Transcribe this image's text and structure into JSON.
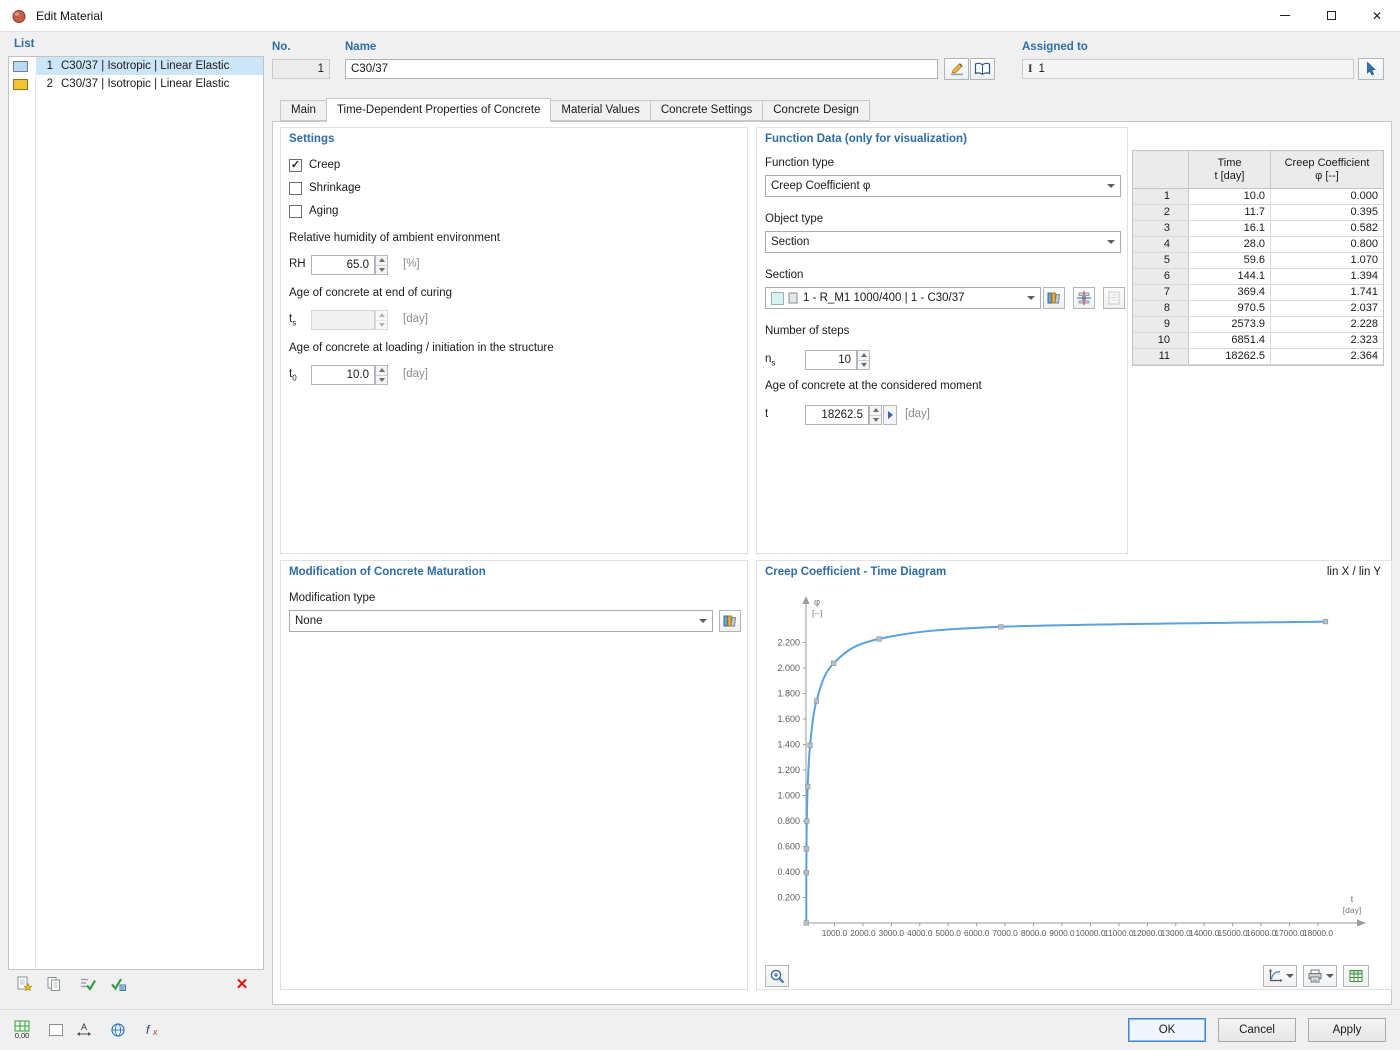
{
  "window": {
    "title": "Edit Material"
  },
  "icons": {
    "close": "✕",
    "delete": "✕",
    "check": "✓"
  },
  "statusbar": {
    "snap_value": "0,00"
  },
  "list_panel": {
    "label": "List",
    "items": [
      {
        "no": "1",
        "name": "C30/37 | Isotropic | Linear Elastic",
        "swatch": "#b7d9f2",
        "selected": true
      },
      {
        "no": "2",
        "name": "C30/37 | Isotropic | Linear Elastic",
        "swatch": "#f0c432",
        "selected": false
      }
    ]
  },
  "header": {
    "no_label": "No.",
    "no_value": "1",
    "name_label": "Name",
    "name_value": "C30/37",
    "assigned_label": "Assigned to",
    "assigned_symbol": "I",
    "assigned_value": "1"
  },
  "tabs": [
    {
      "label": "Main",
      "active": false
    },
    {
      "label": "Time-Dependent Properties of Concrete",
      "active": true
    },
    {
      "label": "Material Values",
      "active": false
    },
    {
      "label": "Concrete Settings",
      "active": false
    },
    {
      "label": "Concrete Design",
      "active": false
    }
  ],
  "settings": {
    "title": "Settings",
    "checkboxes": [
      {
        "label": "Creep",
        "checked": true
      },
      {
        "label": "Shrinkage",
        "checked": false
      },
      {
        "label": "Aging",
        "checked": false
      }
    ],
    "humidity": {
      "label": "Relative humidity of ambient environment",
      "symbol": "RH",
      "value": "65.0",
      "unit": "[%]"
    },
    "curing": {
      "label": "Age of concrete at end of curing",
      "symbol": "t",
      "symbol_sub": "s",
      "value": "",
      "unit": "[day]",
      "enabled": false
    },
    "loading_age": {
      "label": "Age of concrete at loading / initiation in the structure",
      "symbol": "t",
      "symbol_sub": "0",
      "value": "10.0",
      "unit": "[day]"
    }
  },
  "function_data": {
    "title": "Function Data (only for visualization)",
    "function_type": {
      "label": "Function type",
      "value": "Creep Coefficient φ"
    },
    "object_type": {
      "label": "Object type",
      "value": "Section"
    },
    "section": {
      "label": "Section",
      "value": "1 - R_M1 1000/400 | 1 - C30/37",
      "swatch": "#d6f3f1"
    },
    "steps": {
      "label": "Number of steps",
      "symbol": "n",
      "symbol_sub": "s",
      "value": "10"
    },
    "moment_age": {
      "label": "Age of concrete at the considered moment",
      "symbol": "t",
      "value": "18262.5",
      "unit": "[day]"
    }
  },
  "table": {
    "headers": {
      "time_line1": "Time",
      "time_line2": "t [day]",
      "creep_line1": "Creep Coefficient",
      "creep_line2": "φ [--]"
    },
    "rows": [
      {
        "no": "1",
        "time": "10.0",
        "creep": "0.000"
      },
      {
        "no": "2",
        "time": "11.7",
        "creep": "0.395"
      },
      {
        "no": "3",
        "time": "16.1",
        "creep": "0.582"
      },
      {
        "no": "4",
        "time": "28.0",
        "creep": "0.800"
      },
      {
        "no": "5",
        "time": "59.6",
        "creep": "1.070"
      },
      {
        "no": "6",
        "time": "144.1",
        "creep": "1.394"
      },
      {
        "no": "7",
        "time": "369.4",
        "creep": "1.741"
      },
      {
        "no": "8",
        "time": "970.5",
        "creep": "2.037"
      },
      {
        "no": "9",
        "time": "2573.9",
        "creep": "2.228"
      },
      {
        "no": "10",
        "time": "6851.4",
        "creep": "2.323"
      },
      {
        "no": "11",
        "time": "18262.5",
        "creep": "2.364"
      }
    ]
  },
  "maturation": {
    "title": "Modification of Concrete Maturation",
    "type_label": "Modification type",
    "type_value": "None"
  },
  "diagram": {
    "title": "Creep Coefficient - Time Diagram",
    "scale_label": "lin X / lin Y"
  },
  "chart_data": {
    "type": "line",
    "title": "Creep Coefficient - Time Diagram",
    "xlabel": "t",
    "xunit": "[day]",
    "ylabel": "φ",
    "yunit": "[--]",
    "x": [
      10.0,
      11.7,
      16.1,
      28.0,
      59.6,
      144.1,
      369.4,
      970.5,
      2573.9,
      6851.4,
      18262.5
    ],
    "y": [
      0.0,
      0.395,
      0.582,
      0.8,
      1.07,
      1.394,
      1.741,
      2.037,
      2.228,
      2.323,
      2.364
    ],
    "x_ticks": [
      1000,
      2000,
      3000,
      4000,
      5000,
      6000,
      7000,
      8000,
      9000,
      10000,
      11000,
      12000,
      13000,
      14000,
      15000,
      16000,
      17000,
      18000
    ],
    "y_ticks": [
      0.2,
      0.4,
      0.6,
      0.8,
      1.0,
      1.2,
      1.4,
      1.6,
      1.8,
      2.0,
      2.2
    ],
    "xlim": [
      0,
      19400
    ],
    "ylim": [
      0,
      2.55
    ],
    "axes_scale": "lin X / lin Y",
    "line_color": "#5aa2e0",
    "marker_color": "#b9bfc6",
    "axis_color": "#9b9b9b",
    "grid": false,
    "legend": null
  },
  "footer": {
    "ok_label": "OK",
    "cancel_label": "Cancel",
    "apply_label": "Apply"
  }
}
